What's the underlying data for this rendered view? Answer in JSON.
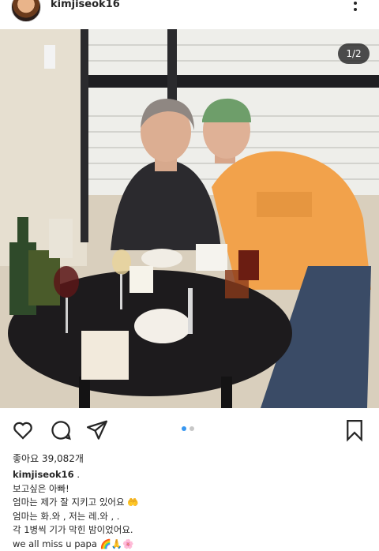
{
  "post": {
    "username": "kimjiseok16",
    "image_counter": "1/2",
    "likes_text": "좋아요 39,082개",
    "caption_username": "kimjiseok16",
    "caption_username_suffix": ".",
    "caption_lines": [
      "보고싶은 아빠!",
      "엄마는 제가 잘 지키고 있어요",
      "엄마는 화.와     , 저는 레.와   ,  .",
      "각 1병씩 기가 막힌 밤이었어요.",
      "we all miss u papa"
    ],
    "carousel": {
      "count": 2,
      "active": 0
    }
  },
  "icons": {
    "header_menu": "more-vertical-icon",
    "like": "heart-outline-icon",
    "comment": "comment-bubble-icon",
    "share": "paper-plane-icon",
    "save": "bookmark-outline-icon"
  },
  "colors": {
    "accent": "#3897f0",
    "text": "#262626",
    "sweatshirt": "#f2a24b"
  }
}
